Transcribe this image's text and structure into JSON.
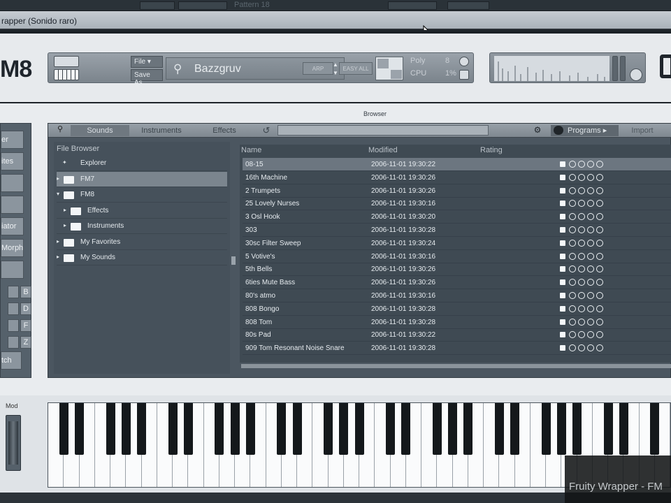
{
  "window": {
    "title": "rapper (Sonido raro)",
    "caption": "Fruity Wrapper - FM"
  },
  "topbar": {
    "pattern_label": "Pattern 18"
  },
  "header": {
    "logo": "M8",
    "file_label": "File ▾",
    "save_as_label": "Save As",
    "preset_search_key": "⚲",
    "preset_name": "Bazzgruv",
    "poly_label": "Poly",
    "poly_value": "8",
    "cpu_label": "CPU",
    "cpu_value": "1%",
    "btn_a": "ARP",
    "btn_b": "EASY ALL"
  },
  "browser": {
    "title": "Browser",
    "tabs": [
      "Sounds",
      "Instruments",
      "Effects"
    ],
    "programs_label": "Programs ▸",
    "import_label": "Import",
    "file_browser_label": "File Browser",
    "columns": [
      "Name",
      "Modified",
      "Rating"
    ],
    "tree": [
      {
        "label": "Explorer",
        "icon": "star",
        "indent": 0,
        "arrow": ""
      },
      {
        "label": "FM7",
        "icon": "folder",
        "indent": 0,
        "arrow": "▸",
        "selected": true
      },
      {
        "label": "FM8",
        "icon": "folder-open",
        "indent": 0,
        "arrow": "▾"
      },
      {
        "label": "Effects",
        "icon": "folder",
        "indent": 1,
        "arrow": "▸"
      },
      {
        "label": "Instruments",
        "icon": "folder",
        "indent": 1,
        "arrow": "▸"
      },
      {
        "label": "My Favorites",
        "icon": "folder",
        "indent": 0,
        "arrow": "▸"
      },
      {
        "label": "My Sounds",
        "icon": "folder",
        "indent": 0,
        "arrow": "▸"
      }
    ],
    "rows": [
      {
        "name": "08-15",
        "modified": "2006-11-01 19:30:22"
      },
      {
        "name": "16th Machine",
        "modified": "2006-11-01 19:30:26"
      },
      {
        "name": "2 Trumpets",
        "modified": "2006-11-01 19:30:26"
      },
      {
        "name": "25 Lovely Nurses",
        "modified": "2006-11-01 19:30:16"
      },
      {
        "name": "3 Osl Hook",
        "modified": "2006-11-01 19:30:20"
      },
      {
        "name": "303",
        "modified": "2006-11-01 19:30:28"
      },
      {
        "name": "30sc Filter Sweep",
        "modified": "2006-11-01 19:30:24"
      },
      {
        "name": "5 Votive's",
        "modified": "2006-11-01 19:30:16"
      },
      {
        "name": "5th Bells",
        "modified": "2006-11-01 19:30:26"
      },
      {
        "name": "6ties Mute Bass",
        "modified": "2006-11-01 19:30:26"
      },
      {
        "name": "80's atmo",
        "modified": "2006-11-01 19:30:16"
      },
      {
        "name": "808 Bongo",
        "modified": "2006-11-01 19:30:28"
      },
      {
        "name": "808 Tom",
        "modified": "2006-11-01 19:30:28"
      },
      {
        "name": "80s Pad",
        "modified": "2006-11-01 19:30:22"
      },
      {
        "name": "909 Tom Resonant Noise Snare",
        "modified": "2006-11-01 19:30:28"
      }
    ]
  },
  "left_nav": {
    "items": [
      "er",
      "ites",
      "",
      "",
      "iator",
      "Morph",
      ""
    ],
    "keys_right": [
      "B",
      "D",
      "F",
      "Z"
    ],
    "last": "tch"
  },
  "keyboard": {
    "mod_label": "Mod",
    "white_keys": 40
  }
}
